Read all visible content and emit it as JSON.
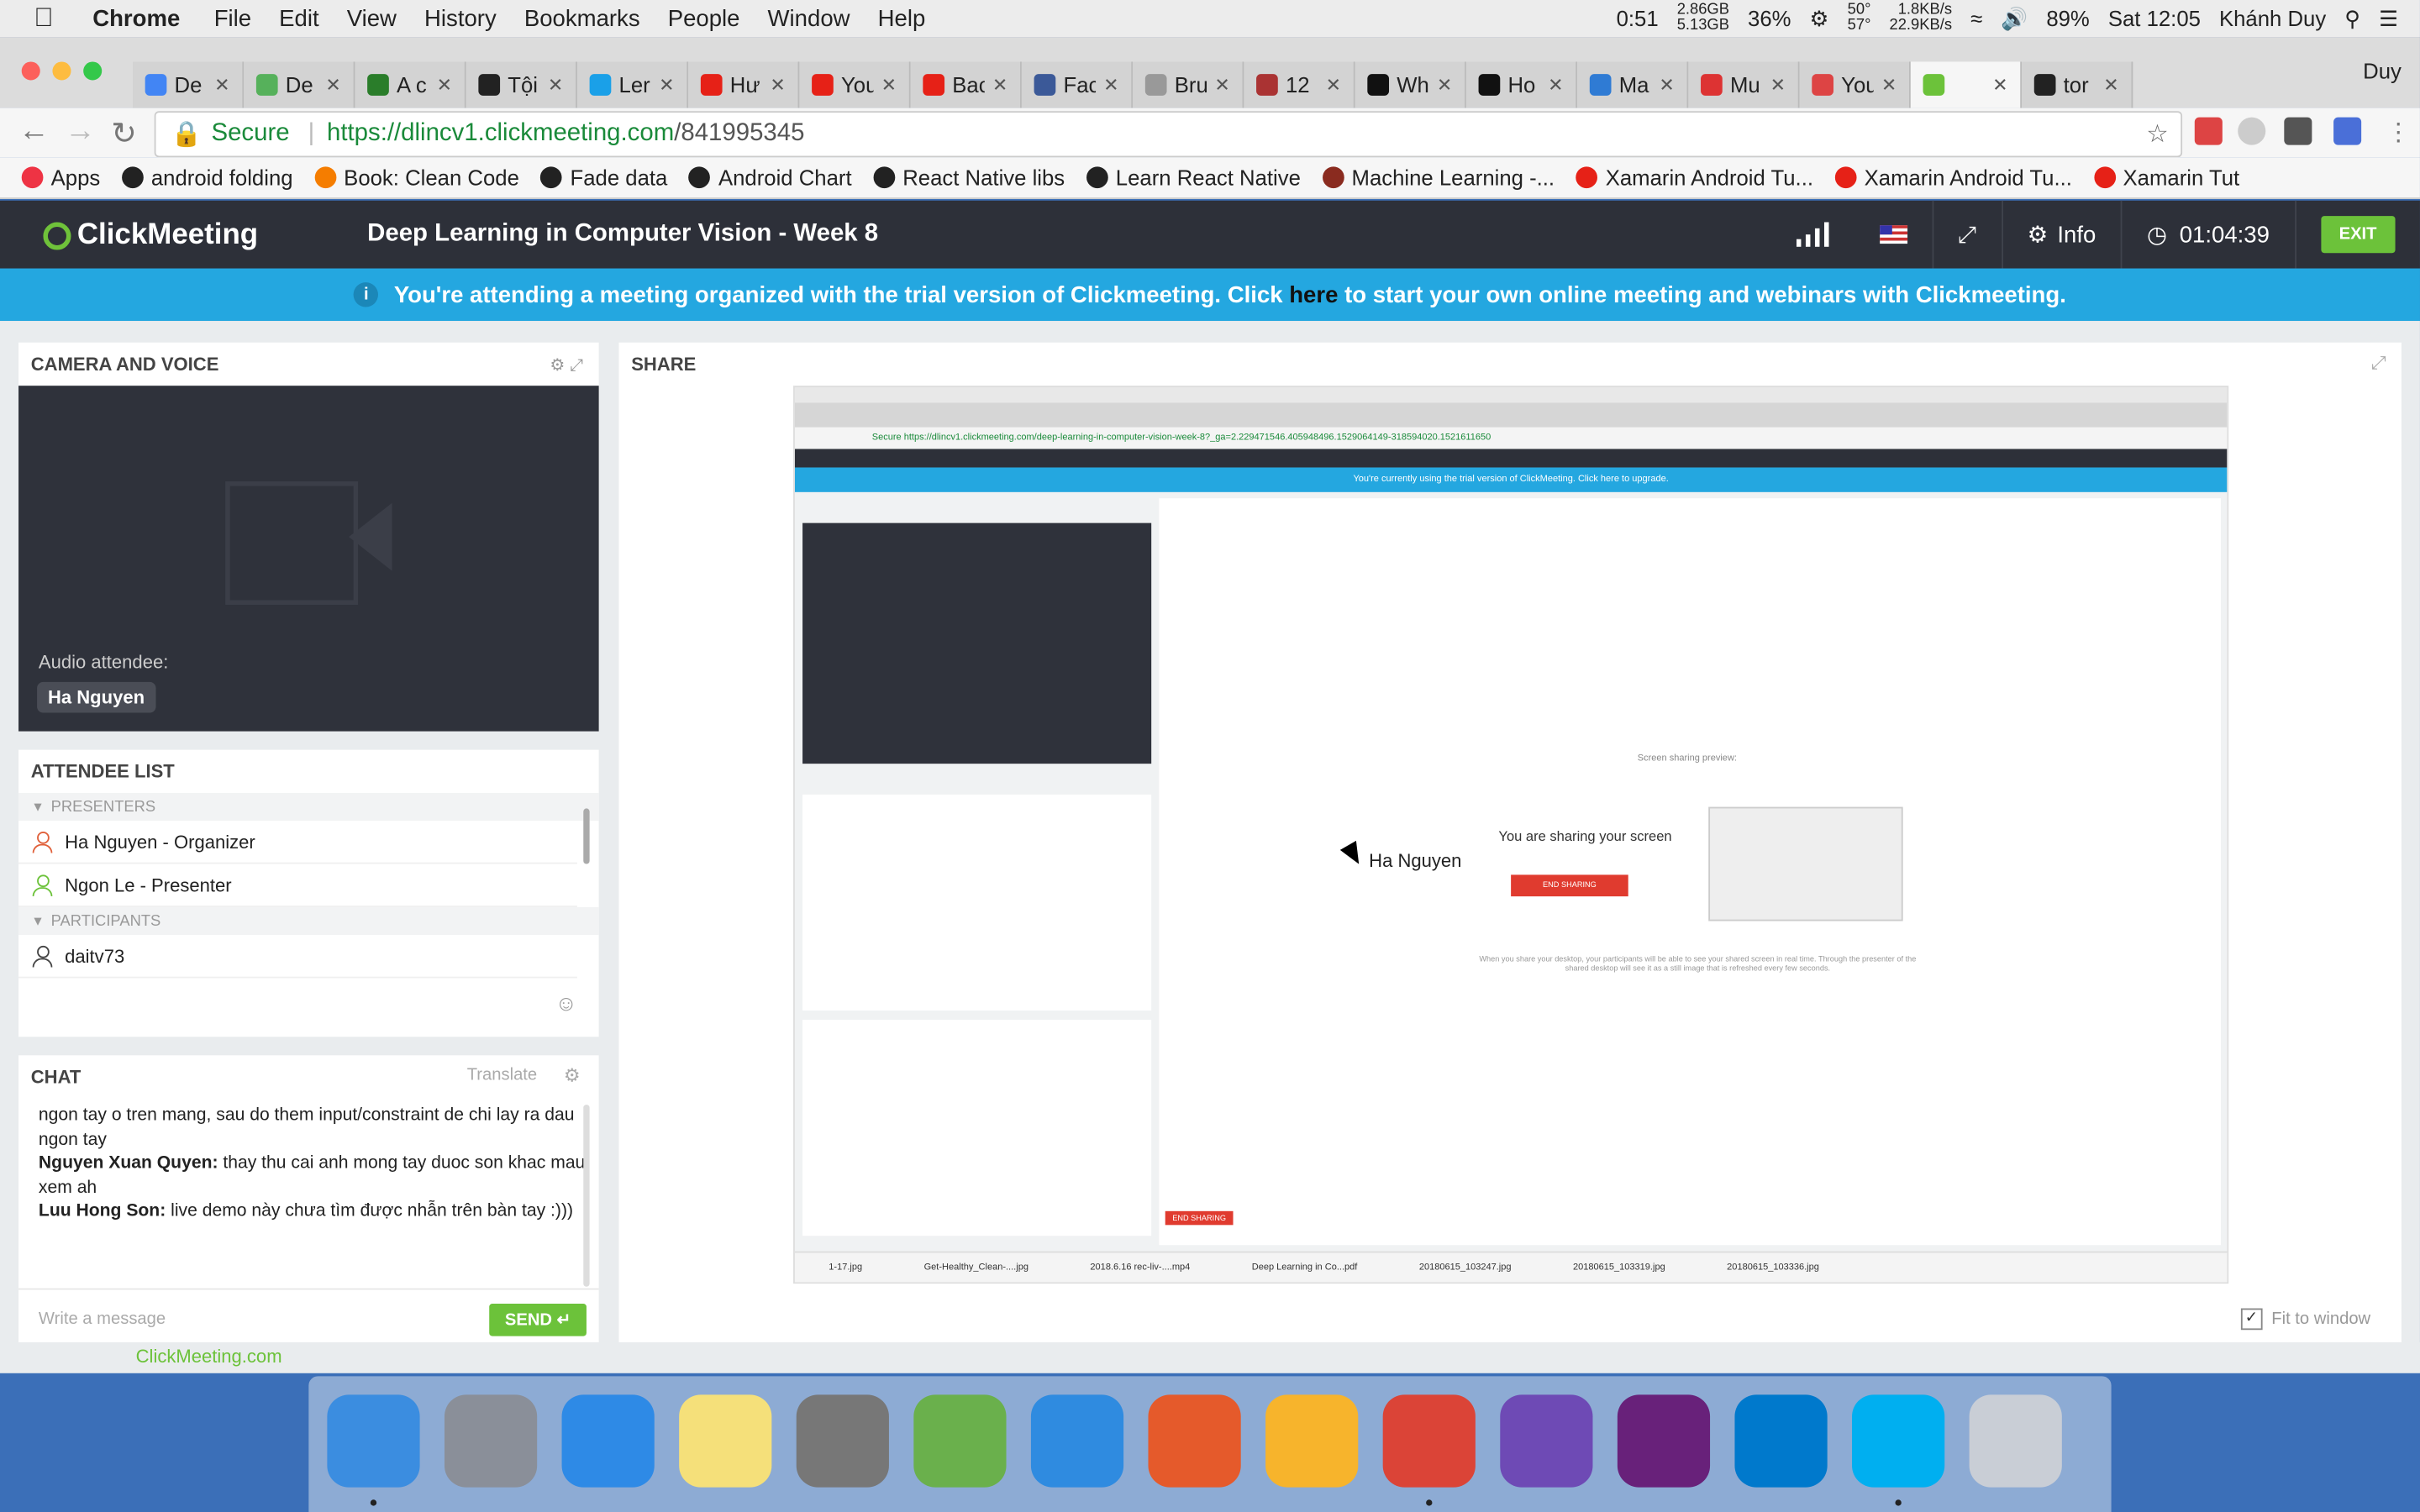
{
  "menubar": {
    "app": "Chrome",
    "menus": [
      "File",
      "Edit",
      "View",
      "History",
      "Bookmarks",
      "People",
      "Window",
      "Help"
    ],
    "battery_time": "0:51",
    "mem": [
      "2.86GB",
      "5.13GB"
    ],
    "cpu": "36%",
    "temps": [
      "50°",
      "57°"
    ],
    "net": [
      "1.8KB/s",
      "22.9KB/s"
    ],
    "battery": "89%",
    "clock": "Sat 12:05",
    "user": "Khánh Duy"
  },
  "tabs": [
    {
      "title": "De",
      "color": "#4285f4"
    },
    {
      "title": "De",
      "color": "#56b15b"
    },
    {
      "title": "A c",
      "color": "#2a7d2a"
    },
    {
      "title": "Tội",
      "color": "#222"
    },
    {
      "title": "Ler",
      "color": "#1aa0e8"
    },
    {
      "title": "Hư",
      "color": "#e62117"
    },
    {
      "title": "You",
      "color": "#e62117"
    },
    {
      "title": "Bac",
      "color": "#e62117"
    },
    {
      "title": "Fac",
      "color": "#3b5998"
    },
    {
      "title": "Bru",
      "color": "#999"
    },
    {
      "title": "12",
      "color": "#a33"
    },
    {
      "title": "Wh",
      "color": "#111"
    },
    {
      "title": "Ho",
      "color": "#111"
    },
    {
      "title": "Ma",
      "color": "#2f7bd4"
    },
    {
      "title": "Mu",
      "color": "#d33"
    },
    {
      "title": "You",
      "color": "#d44"
    },
    {
      "title": "",
      "color": "#6cc23a"
    },
    {
      "title": "tor",
      "color": "#222"
    }
  ],
  "profile": "Duy",
  "address": {
    "secure": "Secure",
    "host": "https://dlincv1.clickmeeting.com",
    "path": "/841995345"
  },
  "bookmarks": [
    {
      "label": "Apps",
      "color": "#e34"
    },
    {
      "label": "android folding",
      "color": "#222"
    },
    {
      "label": "Book: Clean Code",
      "color": "#f57d00"
    },
    {
      "label": "Fade data",
      "color": "#222"
    },
    {
      "label": "Android Chart",
      "color": "#222"
    },
    {
      "label": "React Native libs",
      "color": "#222"
    },
    {
      "label": "Learn React Native",
      "color": "#222"
    },
    {
      "label": "Machine Learning -...",
      "color": "#8a2b1f"
    },
    {
      "label": "Xamarin Android Tu...",
      "color": "#e62117"
    },
    {
      "label": "Xamarin Android Tu...",
      "color": "#e62117"
    },
    {
      "label": "Xamarin Tut",
      "color": "#e62117"
    }
  ],
  "meeting": {
    "logo": "ClickMeeting",
    "title": "Deep Learning in Computer Vision - Week 8",
    "info": "Info",
    "timer": "01:04:39",
    "exit": "EXIT"
  },
  "banner": {
    "pre": "You're attending a meeting organized with the trial version of Clickmeeting. Click",
    "link": "here",
    "post": "to start your own online meeting and webinars with Clickmeeting."
  },
  "camera": {
    "title": "CAMERA AND VOICE",
    "audio_label": "Audio attendee:",
    "attendee": "Ha Nguyen"
  },
  "attendees": {
    "title": "ATTENDEE LIST",
    "presenters_label": "PRESENTERS",
    "participants_label": "PARTICIPANTS",
    "presenters": [
      {
        "name": "Ha Nguyen - Organizer",
        "color": "#e0603a"
      },
      {
        "name": "Ngon Le - Presenter",
        "color": "#6cc23a"
      }
    ],
    "participants": [
      {
        "name": "daitv73",
        "color": "#444"
      }
    ]
  },
  "chat": {
    "title": "CHAT",
    "translate": "Translate",
    "line0": "ngon tay o tren mang, sau do them input/constraint de chi lay ra dau ngon tay",
    "msgs": [
      {
        "author": "Nguyen Xuan Quyen:",
        "text": " thay thu cai anh mong tay duoc son khac mau xem ah"
      },
      {
        "author": "Luu Hong Son:",
        "text": " live demo này chưa tìm được nhẫn trên bàn tay :)))"
      }
    ],
    "placeholder": "Write a message",
    "send": "SEND"
  },
  "share": {
    "title": "SHARE",
    "fit": "Fit to window",
    "inner": {
      "addr": "Secure  https://dlincv1.clickmeeting.com/deep-learning-in-computer-vision-week-8?_ga=2.229471546.405948496.1529064149-318594020.1521611650",
      "banner": "You're currently using the trial version of ClickMeeting. Click here to upgrade.",
      "sharing": "You are sharing your screen",
      "end": "END SHARING",
      "preview": "Screen sharing preview:",
      "note": "When you share your desktop, your participants will be able to see your shared screen in real time. Through the presenter of the shared desktop will see it as a still image that is refreshed every few seconds.",
      "cursor_name": "Ha Nguyen",
      "downloads": [
        "1-17.jpg",
        "Get-Healthy_Clean-....jpg",
        "2018.6.16 rec-liv-....mp4",
        "Deep Learning in Co...pdf",
        "20180615_103247.jpg",
        "20180615_103319.jpg",
        "20180615_103336.jpg"
      ]
    }
  },
  "footer": {
    "brand": "ClickMeeting.com"
  },
  "dock": [
    {
      "name": "finder-icon",
      "color": "#3b8de0"
    },
    {
      "name": "launchpad-icon",
      "color": "#8a8f99"
    },
    {
      "name": "itunes-icon",
      "color": "#2e8ae6"
    },
    {
      "name": "notes-icon",
      "color": "#f5e07a"
    },
    {
      "name": "system-preferences-icon",
      "color": "#777"
    },
    {
      "name": "android-studio-icon",
      "color": "#6ab04c"
    },
    {
      "name": "xcode-icon",
      "color": "#2f8be0"
    },
    {
      "name": "tool-icon",
      "color": "#e55a2b"
    },
    {
      "name": "sketch-icon",
      "color": "#f7b42c"
    },
    {
      "name": "chrome-icon",
      "color": "#db4437"
    },
    {
      "name": "github-desktop-icon",
      "color": "#6e4ab5"
    },
    {
      "name": "visual-studio-icon",
      "color": "#68217a"
    },
    {
      "name": "vscode-icon",
      "color": "#0079cc"
    },
    {
      "name": "skype-icon",
      "color": "#00aff0"
    },
    {
      "name": "trash-icon",
      "color": "#c9ced6"
    }
  ]
}
